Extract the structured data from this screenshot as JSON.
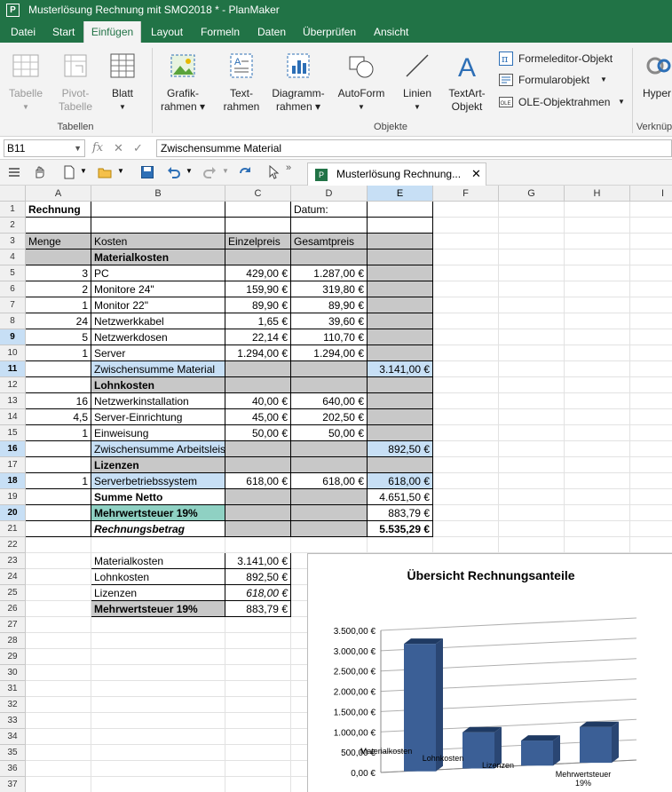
{
  "window": {
    "title": "Musterlösung Rechnung mit SMO2018 * - PlanMaker",
    "app_icon": "P"
  },
  "menu": [
    "Datei",
    "Start",
    "Einfügen",
    "Layout",
    "Formeln",
    "Daten",
    "Überprüfen",
    "Ansicht"
  ],
  "menu_active": "Einfügen",
  "ribbon": {
    "tabelle": "Tabelle",
    "pivot": [
      "Pivot-",
      "Tabelle"
    ],
    "blatt": "Blatt",
    "grafik": [
      "Grafik-",
      "rahmen ▾"
    ],
    "text": [
      "Text-",
      "rahmen"
    ],
    "diagramm": [
      "Diagramm-",
      "rahmen ▾"
    ],
    "autoform": "AutoForm",
    "linien": "Linien",
    "textart": [
      "TextArt-",
      "Objekt"
    ],
    "formeleditor": "Formeleditor-Objekt",
    "formularobjekt": "Formularobjekt",
    "ole": "OLE-Objektrahmen",
    "hyper": "Hyper",
    "groups": {
      "tabellen": "Tabellen",
      "objekte": "Objekte",
      "verknuepf": "Verknüp"
    }
  },
  "formula": {
    "namebox": "B11",
    "fx": "fx",
    "content": "Zwischensumme Material"
  },
  "doc_tab": "Musterlösung Rechnung...",
  "columns": [
    "A",
    "B",
    "C",
    "D",
    "E",
    "F",
    "G",
    "H",
    "I"
  ],
  "selected_col": "E",
  "cells": {
    "r1": {
      "a": "Rechnung",
      "d": "Datum:"
    },
    "r3": {
      "a": "Menge",
      "b": "Kosten",
      "c": "Einzelpreis",
      "d": "Gesamtpreis"
    },
    "r4": {
      "b": "Materialkosten"
    },
    "r5": {
      "a": "3",
      "b": "PC",
      "c": "429,00 €",
      "d": "1.287,00 €"
    },
    "r6": {
      "a": "2",
      "b": "Monitore 24\"",
      "c": "159,90 €",
      "d": "319,80 €"
    },
    "r7": {
      "a": "1",
      "b": "Monitor 22\"",
      "c": "89,90 €",
      "d": "89,90 €"
    },
    "r8": {
      "a": "24",
      "b": "Netzwerkkabel",
      "c": "1,65 €",
      "d": "39,60 €"
    },
    "r9": {
      "a": "5",
      "b": "Netzwerkdosen",
      "c": "22,14 €",
      "d": "110,70 €"
    },
    "r10": {
      "a": "1",
      "b": "Server",
      "c": "1.294,00 €",
      "d": "1.294,00 €"
    },
    "r11": {
      "b": "Zwischensumme Material",
      "e": "3.141,00 €"
    },
    "r12": {
      "b": "Lohnkosten"
    },
    "r13": {
      "a": "16",
      "b": "Netzwerkinstallation",
      "c": "40,00 €",
      "d": "640,00 €"
    },
    "r14": {
      "a": "4,5",
      "b": "Server-Einrichtung",
      "c": "45,00 €",
      "d": "202,50 €"
    },
    "r15": {
      "a": "1",
      "b": "Einweisung",
      "c": "50,00 €",
      "d": "50,00 €"
    },
    "r16": {
      "b": "Zwischensumme Arbeitsleis",
      "e": "892,50 €"
    },
    "r17": {
      "b": "Lizenzen"
    },
    "r18": {
      "a": "1",
      "b": "Serverbetriebssystem",
      "c": "618,00 €",
      "d": "618,00 €",
      "e": "618,00 €"
    },
    "r19": {
      "b": "Summe Netto",
      "e": "4.651,50 €"
    },
    "r20": {
      "b": "Mehrwertsteuer 19%",
      "e": "883,79 €"
    },
    "r21": {
      "b": "Rechnungsbetrag",
      "e": "5.535,29 €"
    },
    "r23": {
      "b": "Materialkosten",
      "c": "3.141,00 €"
    },
    "r24": {
      "b": "Lohnkosten",
      "c": "892,50 €"
    },
    "r25": {
      "b": "Lizenzen",
      "c": "618,00 €"
    },
    "r26": {
      "b": "Mehrwertsteuer 19%",
      "c": "883,79 €"
    }
  },
  "chart_data": {
    "type": "bar",
    "title": "Übersicht Rechnungsanteile",
    "categories": [
      "Materialkosten",
      "Lohnkosten",
      "Lizenzen",
      "Mehrwertsteuer 19%"
    ],
    "values": [
      3141.0,
      892.5,
      618.0,
      883.79
    ],
    "ylim": [
      0,
      3500
    ],
    "yticks": [
      "0,00 €",
      "500,00 €",
      "1.000,00 €",
      "1.500,00 €",
      "2.000,00 €",
      "2.500,00 €",
      "3.000,00 €",
      "3.500,00 €"
    ],
    "grid": true,
    "bar_color": "#3b5f96"
  }
}
